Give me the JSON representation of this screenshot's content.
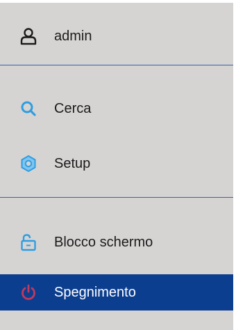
{
  "menu": {
    "user": {
      "label": "admin",
      "icon": "user-icon"
    },
    "items": [
      {
        "label": "Cerca",
        "icon": "search-icon"
      },
      {
        "label": "Setup",
        "icon": "gear-icon"
      },
      {
        "label": "Blocco schermo",
        "icon": "lock-icon"
      },
      {
        "label": "Spegnimento",
        "icon": "power-icon",
        "selected": true
      }
    ]
  },
  "colors": {
    "background": "#d6d4d3",
    "separator": "#3b5fa8",
    "selected_background": "#0c3e8f",
    "icon_accent": "#2f9de0",
    "power_icon": "#c2395d"
  }
}
